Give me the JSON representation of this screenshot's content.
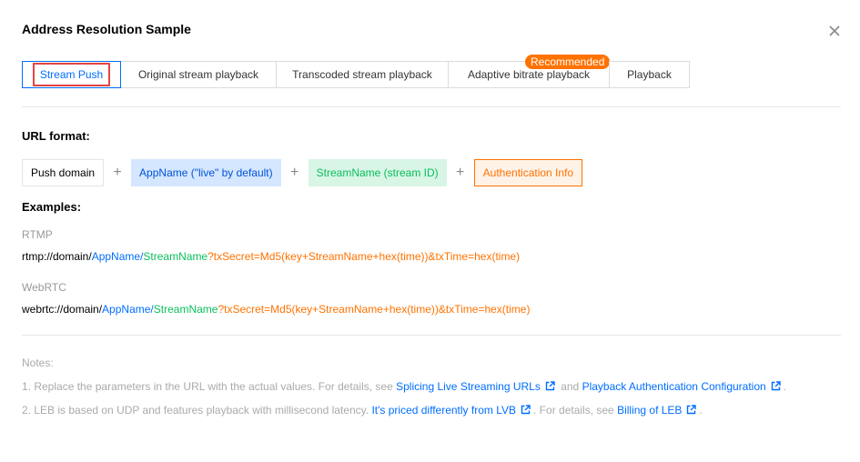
{
  "dialog": {
    "title": "Address Resolution Sample"
  },
  "tabs": [
    {
      "label": "Stream Push",
      "active": true
    },
    {
      "label": "Original stream playback",
      "active": false
    },
    {
      "label": "Transcoded stream playback",
      "active": false
    },
    {
      "label": "Adaptive bitrate playback",
      "active": false,
      "badge": "Recommended"
    },
    {
      "label": "Playback",
      "active": false
    }
  ],
  "url_format": {
    "title": "URL format:",
    "parts": [
      {
        "label": "Push domain"
      },
      {
        "label": "AppName (\"live\" by default)"
      },
      {
        "label": "StreamName (stream ID)"
      },
      {
        "label": "Authentication Info"
      }
    ],
    "plus": "+"
  },
  "examples": {
    "title": "Examples:",
    "rtmp": {
      "label": "RTMP",
      "prefix": "rtmp://domain/",
      "app": "AppName",
      "sep": "/",
      "stream": "StreamName",
      "auth": "?txSecret=Md5(key+StreamName+hex(time))&txTime=hex(time)"
    },
    "webrtc": {
      "label": "WebRTC",
      "prefix": "webrtc://domain/",
      "app": "AppName",
      "sep": "/",
      "stream": "StreamName",
      "auth": "?txSecret=Md5(key+StreamName+hex(time))&txTime=hex(time)"
    }
  },
  "notes": {
    "label": "Notes:",
    "note1": {
      "text_a": "1. Replace the parameters in the URL with the actual values. For details, see ",
      "link1": "Splicing Live Streaming URLs",
      "text_b": " and ",
      "link2": "Playback Authentication Configuration",
      "text_c": "."
    },
    "note2": {
      "text_a": "2. LEB is based on UDP and features playback with millisecond latency. ",
      "link1": "It's priced differently from LVB",
      "text_b": ". For details, see ",
      "link2": "Billing of LEB",
      "text_c": "."
    }
  },
  "colors": {
    "primary": "#006eff",
    "app": "#006eff",
    "stream": "#0abf5b",
    "auth": "#ff7200",
    "badge": "#ff7200",
    "highlight": "#e54545"
  },
  "icons": {
    "close": "close-icon",
    "external": "external-link-icon"
  }
}
